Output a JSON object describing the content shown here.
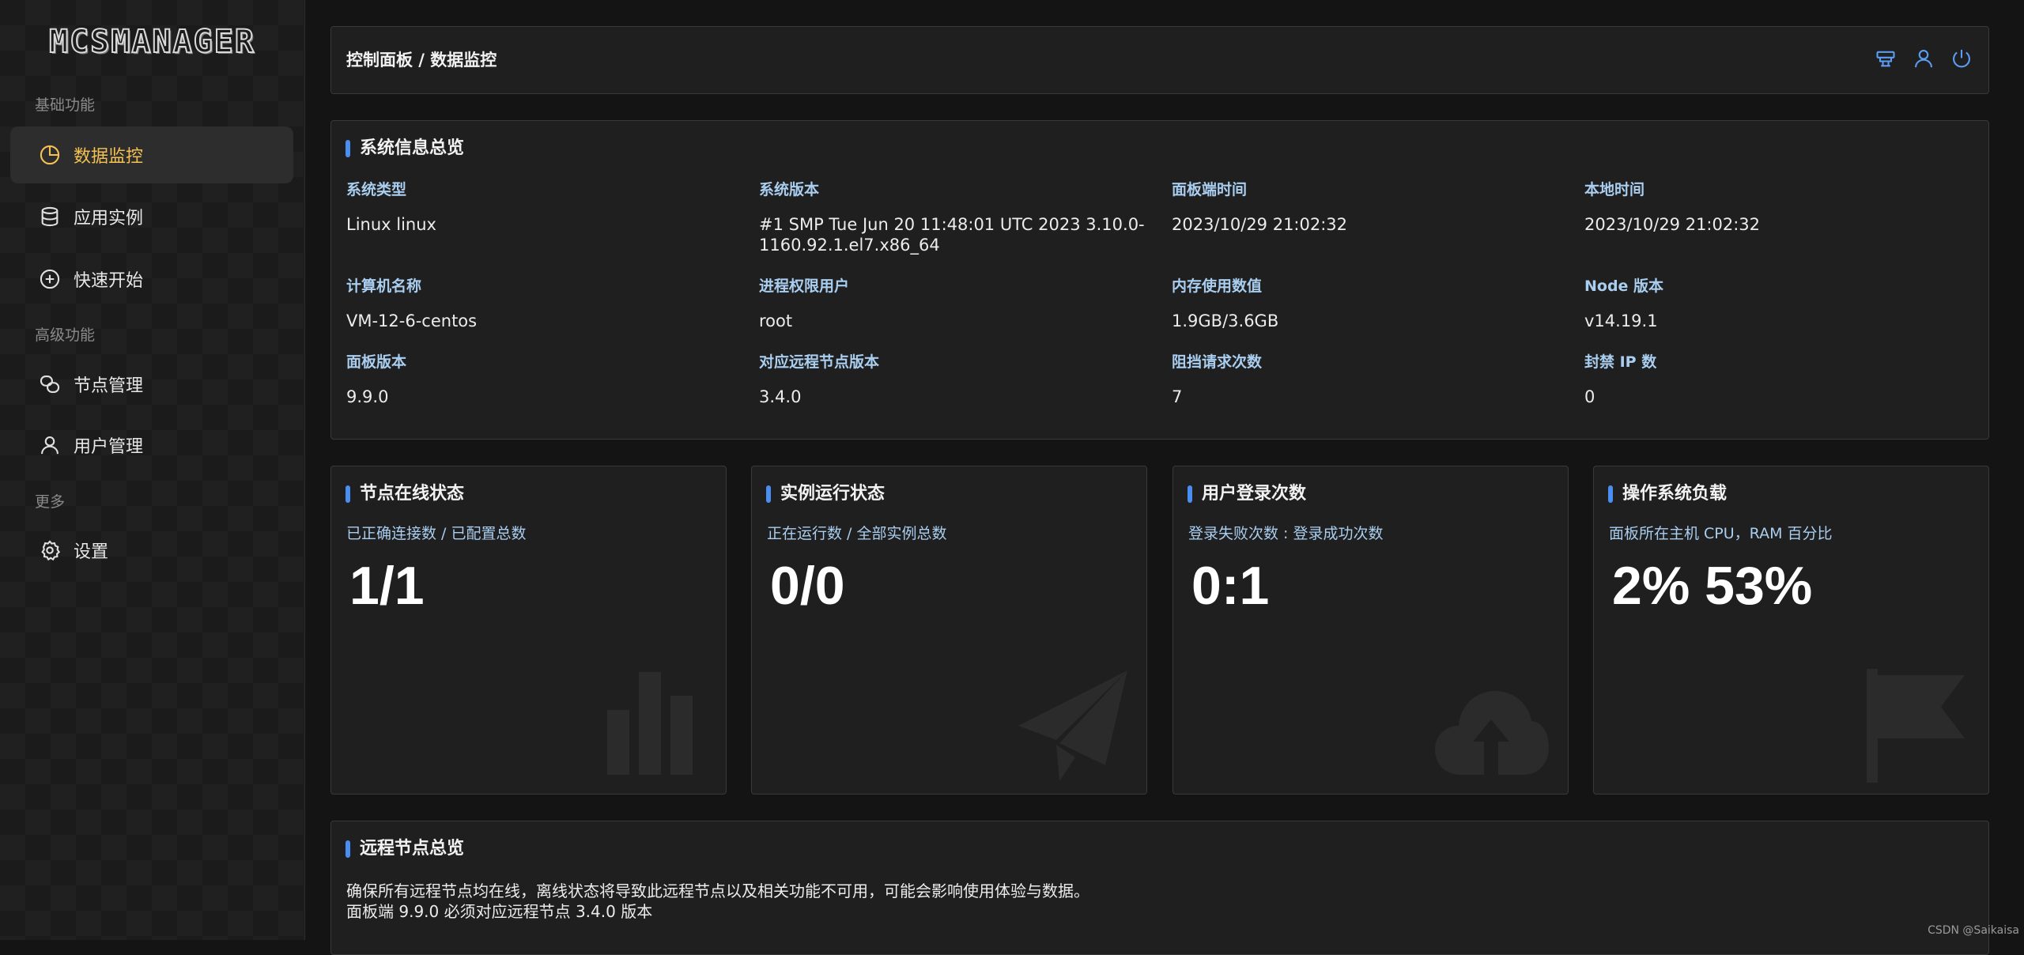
{
  "app": {
    "logo": "MCSMANAGER",
    "watermark": "CSDN @Saikaisa"
  },
  "sidebar": {
    "sections": {
      "basic": "基础功能",
      "advanced": "高级功能",
      "more": "更多"
    },
    "items": [
      {
        "label": "数据监控",
        "icon": "pie-chart-icon",
        "active": true
      },
      {
        "label": "应用实例",
        "icon": "database-icon"
      },
      {
        "label": "快速开始",
        "icon": "plus-circle-icon"
      },
      {
        "label": "节点管理",
        "icon": "nodes-icon"
      },
      {
        "label": "用户管理",
        "icon": "user-icon"
      },
      {
        "label": "设置",
        "icon": "gear-icon"
      }
    ]
  },
  "header": {
    "breadcrumb": "控制面板 / 数据监控",
    "icons": [
      "theme-icon",
      "user-icon",
      "power-icon"
    ]
  },
  "system_info": {
    "title": "系统信息总览",
    "fields": [
      {
        "label": "系统类型",
        "value": "Linux linux"
      },
      {
        "label": "系统版本",
        "value": "#1 SMP Tue Jun 20 11:48:01 UTC 2023 3.10.0-1160.92.1.el7.x86_64"
      },
      {
        "label": "面板端时间",
        "value": "2023/10/29 21:02:32"
      },
      {
        "label": "本地时间",
        "value": "2023/10/29 21:02:32"
      },
      {
        "label": "计算机名称",
        "value": "VM-12-6-centos"
      },
      {
        "label": "进程权限用户",
        "value": "root"
      },
      {
        "label": "内存使用数值",
        "value": "1.9GB/3.6GB"
      },
      {
        "label": "Node 版本",
        "value": "v14.19.1"
      },
      {
        "label": "面板版本",
        "value": "9.9.0"
      },
      {
        "label": "对应远程节点版本",
        "value": "3.4.0"
      },
      {
        "label": "阻挡请求次数",
        "value": "7"
      },
      {
        "label": "封禁 IP 数",
        "value": "0"
      }
    ]
  },
  "stats": [
    {
      "title": "节点在线状态",
      "subtitle": "已正确连接数 / 已配置总数",
      "value": "1/1",
      "icon": "bar-chart-icon"
    },
    {
      "title": "实例运行状态",
      "subtitle": "正在运行数 / 全部实例总数",
      "value": "0/0",
      "icon": "paper-plane-icon"
    },
    {
      "title": "用户登录次数",
      "subtitle": "登录失败次数 : 登录成功次数",
      "value": "0:1",
      "icon": "cloud-upload-icon"
    },
    {
      "title": "操作系统负载",
      "subtitle": "面板所在主机 CPU，RAM 百分比",
      "value": "2% 53%",
      "icon": "flag-icon"
    }
  ],
  "remote": {
    "title": "远程节点总览",
    "line1": "确保所有远程节点均在线，离线状态将导致此远程节点以及相关功能不可用，可能会影响使用体验与数据。",
    "line2": "面板端 9.9.0 必须对应远程节点 3.4.0 版本"
  },
  "colors": {
    "accent": "#4b8ef2",
    "active_nav": "#f3c253",
    "label": "#a9cef0"
  }
}
